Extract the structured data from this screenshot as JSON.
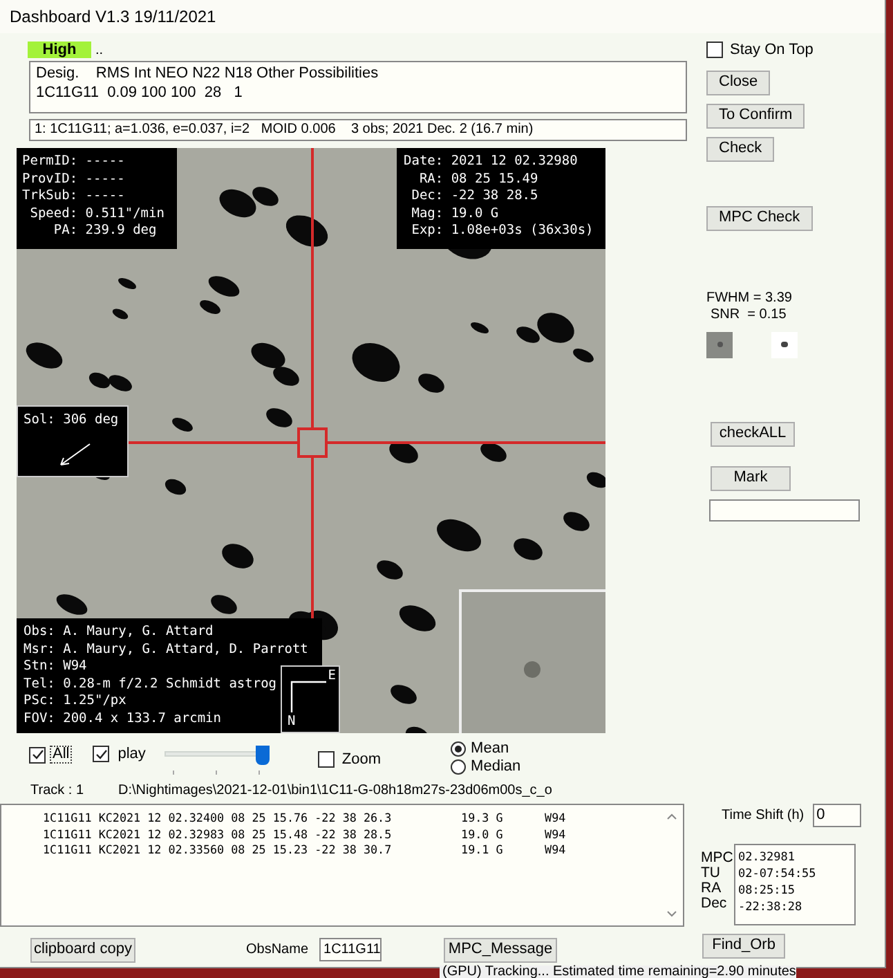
{
  "window": {
    "title": "Dashboard V1.3 19/11/2021"
  },
  "priority": {
    "label": "High",
    "suffix": ".."
  },
  "desig_table": {
    "lines": [
      "Desig.    RMS Int NEO N22 N18 Other Possibilities",
      "1C11G11  0.09 100 100  28   1"
    ]
  },
  "orbit_line": "1: 1C11G11; a=1.036, e=0.037, i=2   MOID 0.006    3 obs; 2021 Dec. 2 (16.7 min)",
  "overlays": {
    "ids": [
      "PermID: -----",
      "ProvID: -----",
      "TrkSub: -----",
      " Speed: 0.511\"/min",
      "    PA: 239.9 deg"
    ],
    "ephemeris": [
      "Date: 2021 12 02.32980",
      "  RA: 08 25 15.49",
      " Dec: -22 38 28.5",
      " Mag: 19.0 G",
      " Exp: 1.08e+03s (36x30s)"
    ],
    "sol": "Sol: 306 deg",
    "observer": [
      "Obs: A. Maury, G. Attard",
      "Msr: A. Maury, G. Attard, D. Parrott",
      "Stn: W94",
      "Tel: 0.28-m f/2.2 Schmidt astrog",
      "PSc: 1.25\"/px",
      "FOV: 200.4 x 133.7 arcmin"
    ],
    "compass": {
      "east": "E",
      "north": "N"
    }
  },
  "controls": {
    "all": {
      "label": "All",
      "checked": true
    },
    "play": {
      "label": "play",
      "checked": true
    },
    "slider": {
      "level": 0.93
    },
    "zoom": {
      "label": "Zoom",
      "checked": false
    },
    "stack_mode": [
      {
        "label": "Mean",
        "selected": true
      },
      {
        "label": "Median",
        "selected": false
      }
    ]
  },
  "track": {
    "label": "Track : 1",
    "path": "D:\\Nightimages\\2021-12-01\\bin1\\1C11-G-08h18m27s-23d06m00s_c_o"
  },
  "observations": [
    "1C11G11 KC2021 12 02.32400 08 25 15.76 -22 38 26.3          19.3 G      W94",
    "1C11G11 KC2021 12 02.32983 08 25 15.48 -22 38 28.5          19.0 G      W94",
    "1C11G11 KC2021 12 02.33560 08 25 15.23 -22 38 30.7          19.1 G      W94"
  ],
  "right_panel": {
    "stay_on_top": {
      "label": "Stay On Top",
      "checked": false
    },
    "buttons": [
      "Close",
      "To Confirm",
      "Check"
    ],
    "mpc_check": "MPC Check",
    "fwhm": "FWHM = 3.39",
    "snr": "SNR  = 0.15",
    "check_all": "checkALL",
    "mark": "Mark"
  },
  "time_shift": {
    "label": "Time Shift (h)",
    "value": "0"
  },
  "mpc_box": {
    "labels": [
      "MPC",
      "TU",
      "RA",
      "Dec"
    ],
    "values": [
      "02.32981",
      "02-07:54:55",
      "08:25:15",
      "-22:38:28"
    ]
  },
  "bottom": {
    "clipboard": "clipboard copy",
    "obsname_label": "ObsName",
    "obsname_value": "1C11G11",
    "mpc_message": "MPC_Message",
    "find_orb": "Find_Orb"
  },
  "background_status": "(GPU) Tracking... Estimated time remaining=2.90 minutes"
}
